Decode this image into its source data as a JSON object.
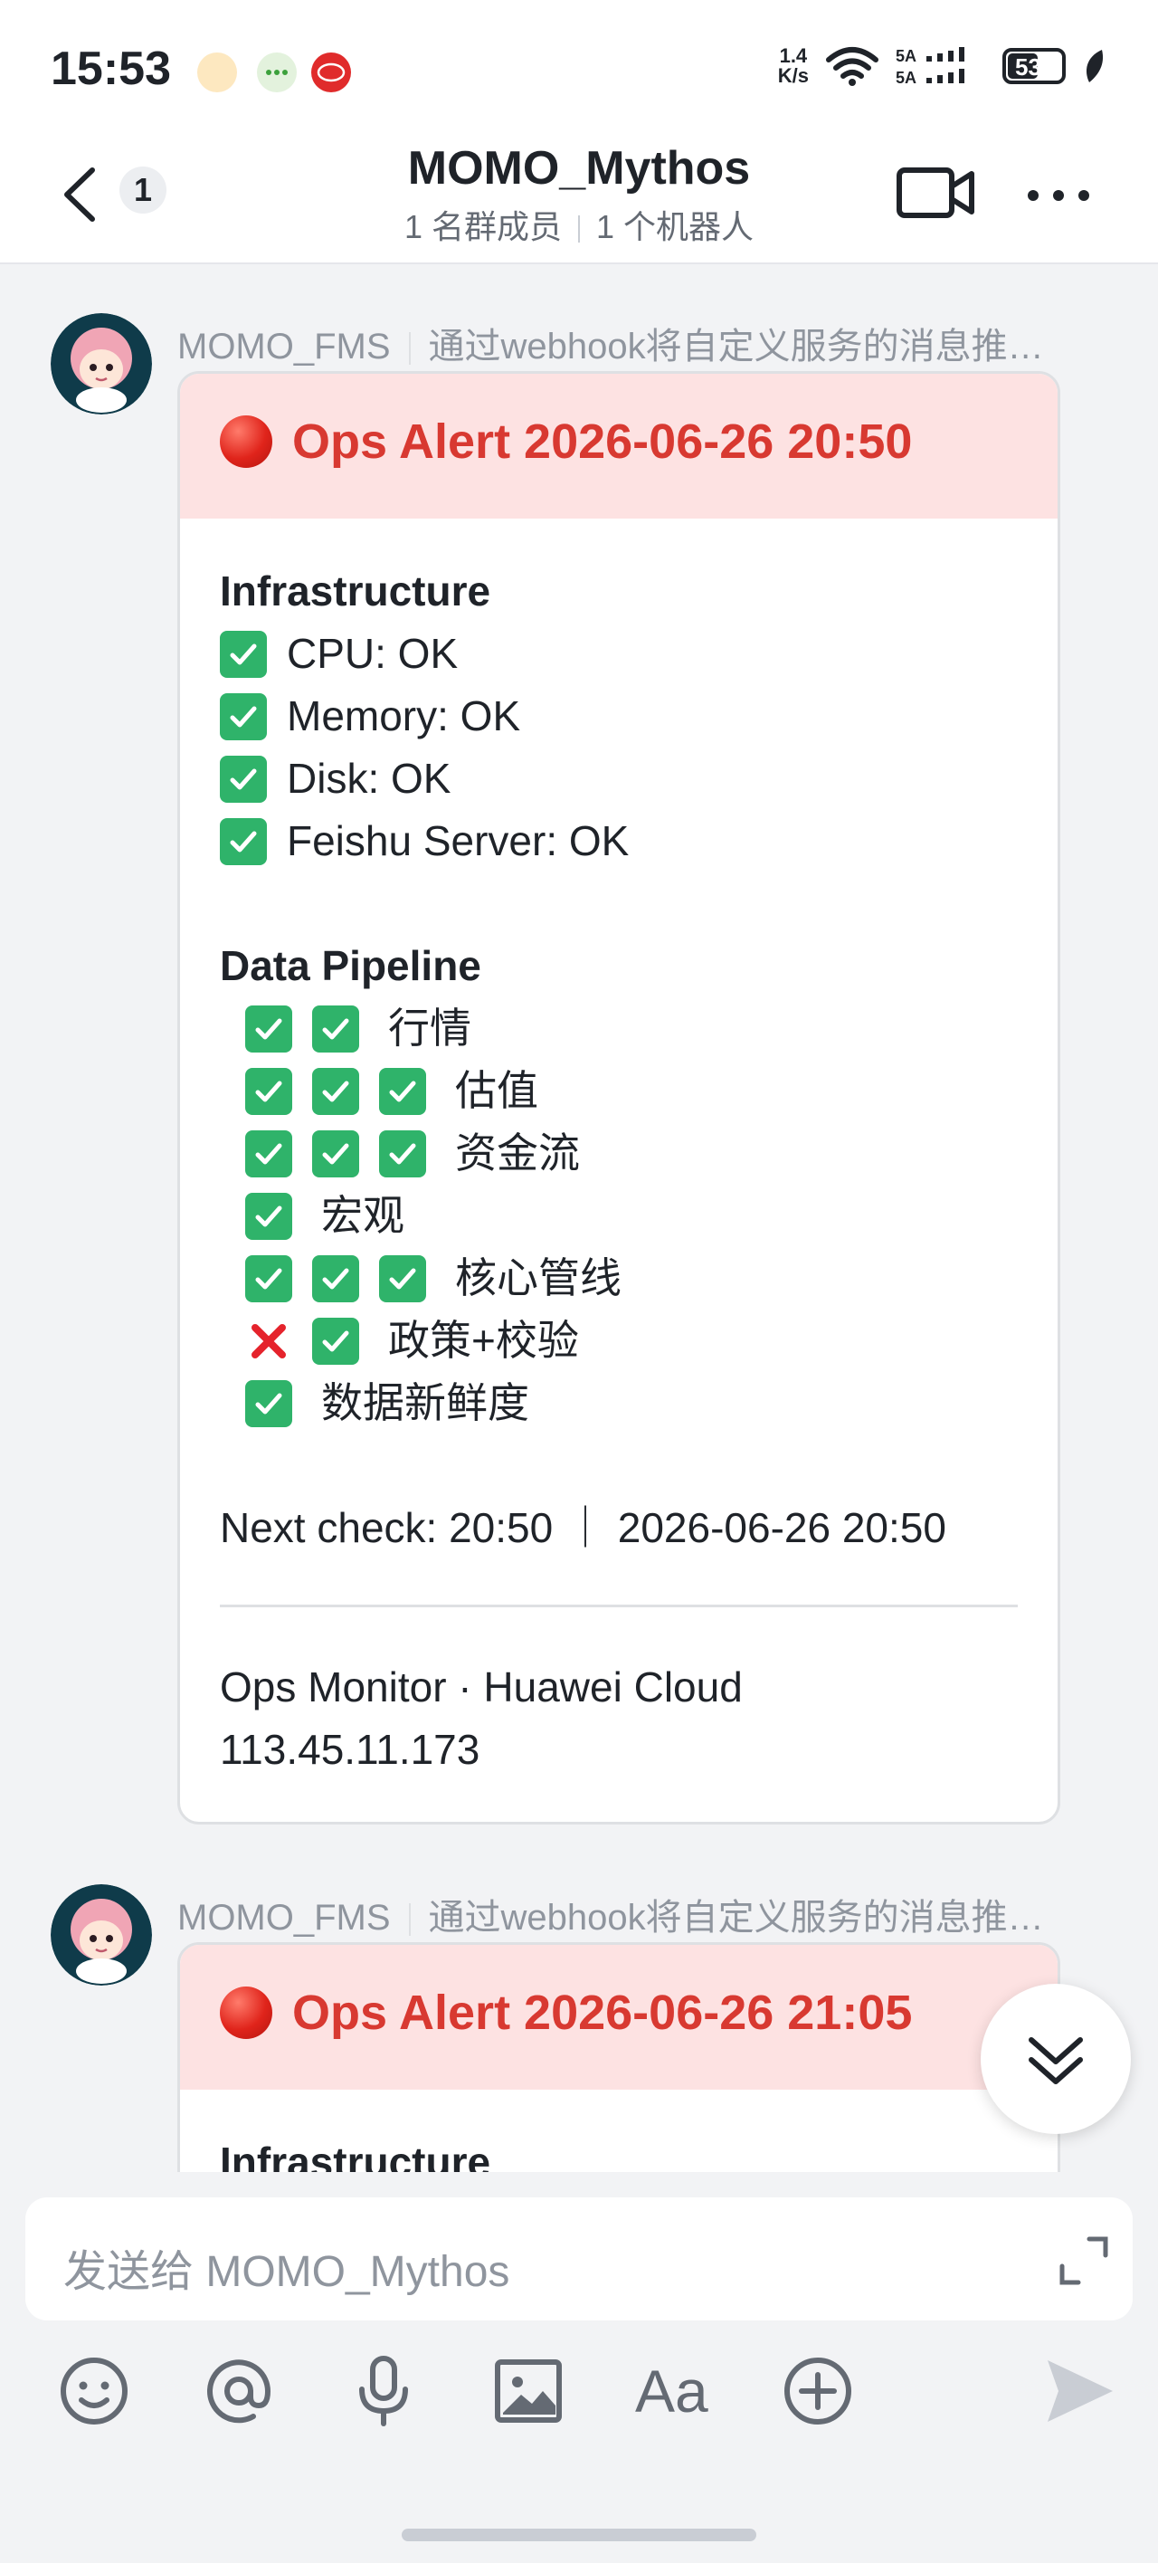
{
  "status_bar": {
    "time": "15:53",
    "network_speed": "1.4\nK/s",
    "network": "6",
    "sim": "5A",
    "battery": "53"
  },
  "header": {
    "unread_count": "1",
    "title": "MOMO_Mythos",
    "members": "1 名群成员",
    "bots": "1 个机器人"
  },
  "messages": [
    {
      "sender": "MOMO_FMS",
      "sender_desc": "通过webhook将自定义服务的消息推…",
      "title": "Ops Alert 2026-06-26 20:50",
      "infra_title": "Infrastructure",
      "infra": [
        "CPU: OK",
        "Memory: OK",
        "Disk: OK",
        "Feishu Server: OK"
      ],
      "pipeline_title": "Data Pipeline",
      "pipeline": [
        {
          "label": "行情",
          "marks": [
            "ok",
            "ok"
          ]
        },
        {
          "label": "估值",
          "marks": [
            "ok",
            "ok",
            "ok"
          ]
        },
        {
          "label": "资金流",
          "marks": [
            "ok",
            "ok",
            "ok"
          ]
        },
        {
          "label": "宏观",
          "marks": [
            "ok"
          ]
        },
        {
          "label": "核心管线",
          "marks": [
            "ok",
            "ok",
            "ok"
          ]
        },
        {
          "label": "政策+校验",
          "marks": [
            "bad",
            "ok"
          ]
        },
        {
          "label": "数据新鲜度",
          "marks": [
            "ok"
          ]
        }
      ],
      "next_check": "Next check: 20:50 ｜ 2026-06-26 20:50",
      "footer_line1": "Ops Monitor · Huawei Cloud",
      "footer_line2": "113.45.11.173"
    },
    {
      "sender": "MOMO_FMS",
      "sender_desc": "通过webhook将自定义服务的消息推…",
      "title": "Ops Alert 2026-06-26 21:05",
      "infra_title": "Infrastructure"
    }
  ],
  "composer": {
    "placeholder": "发送给 MOMO_Mythos"
  },
  "toolbar": {
    "emoji": "emoji-icon",
    "mention": "at-icon",
    "voice": "microphone-icon",
    "image": "image-icon",
    "format": "Aa",
    "more": "plus-circle-icon",
    "send": "send-icon"
  },
  "colors": {
    "alert_red": "#d83931",
    "alert_bg": "#fde2e2",
    "check_green": "#2fb36a"
  }
}
